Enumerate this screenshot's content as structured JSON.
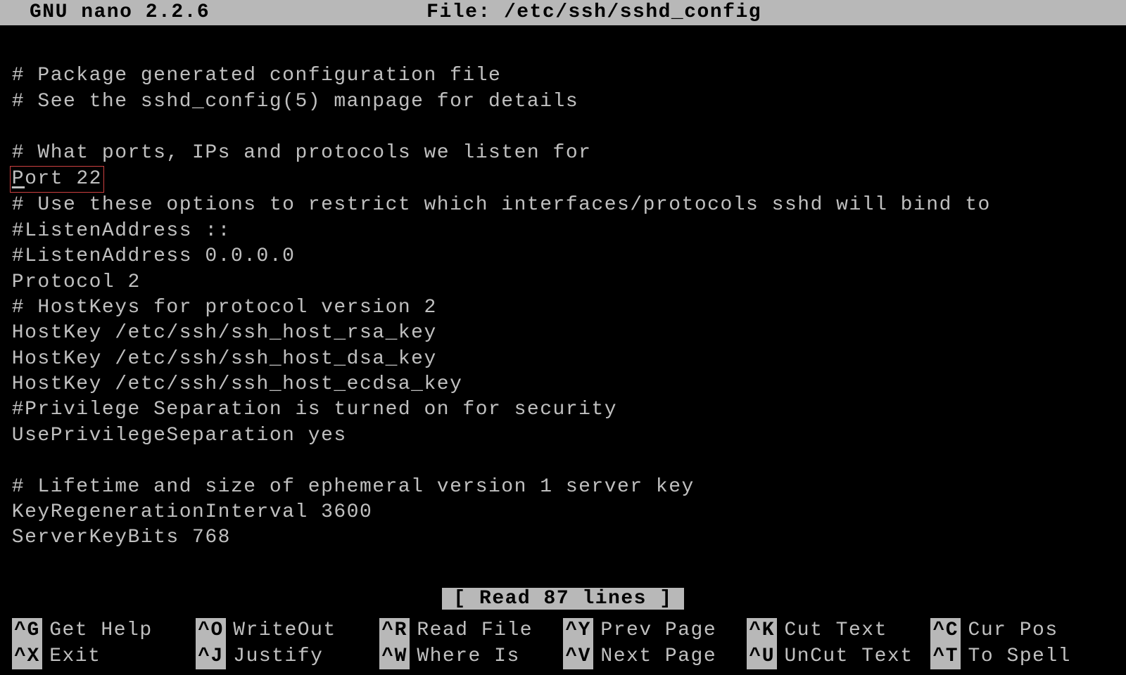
{
  "title": {
    "left": "GNU nano 2.2.6",
    "center": "File: /etc/ssh/sshd_config"
  },
  "file": {
    "lines": [
      "",
      "# Package generated configuration file",
      "# See the sshd_config(5) manpage for details",
      "",
      "# What ports, IPs and protocols we listen for",
      "Port 22",
      "# Use these options to restrict which interfaces/protocols sshd will bind to",
      "#ListenAddress ::",
      "#ListenAddress 0.0.0.0",
      "Protocol 2",
      "# HostKeys for protocol version 2",
      "HostKey /etc/ssh/ssh_host_rsa_key",
      "HostKey /etc/ssh/ssh_host_dsa_key",
      "HostKey /etc/ssh/ssh_host_ecdsa_key",
      "#Privilege Separation is turned on for security",
      "UsePrivilegeSeparation yes",
      "",
      "# Lifetime and size of ephemeral version 1 server key",
      "KeyRegenerationInterval 3600",
      "ServerKeyBits 768"
    ],
    "highlight_line_index": 5,
    "cursor_line_index": 5,
    "cursor_col": 0
  },
  "status": "[ Read 87 lines ]",
  "help": [
    {
      "key": "^G",
      "label": "Get Help"
    },
    {
      "key": "^O",
      "label": "WriteOut"
    },
    {
      "key": "^R",
      "label": "Read File"
    },
    {
      "key": "^Y",
      "label": "Prev Page"
    },
    {
      "key": "^K",
      "label": "Cut Text"
    },
    {
      "key": "^C",
      "label": "Cur Pos"
    },
    {
      "key": "^X",
      "label": "Exit"
    },
    {
      "key": "^J",
      "label": "Justify"
    },
    {
      "key": "^W",
      "label": "Where Is"
    },
    {
      "key": "^V",
      "label": "Next Page"
    },
    {
      "key": "^U",
      "label": "UnCut Text"
    },
    {
      "key": "^T",
      "label": "To Spell"
    }
  ]
}
